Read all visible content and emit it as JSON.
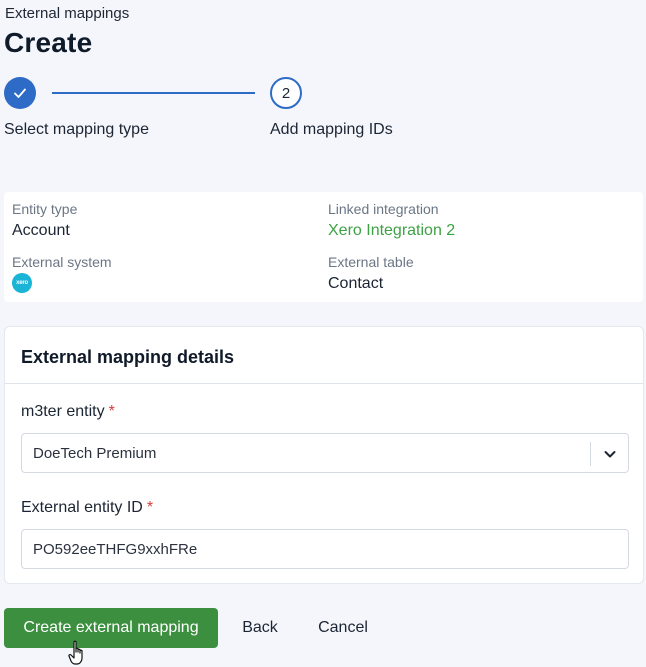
{
  "header": {
    "breadcrumb": "External mappings",
    "title": "Create"
  },
  "stepper": {
    "steps": [
      {
        "label": "Select mapping type",
        "state": "complete",
        "icon": "check-icon"
      },
      {
        "label": "Add mapping IDs",
        "state": "active",
        "number": "2"
      }
    ]
  },
  "summary": {
    "entity_type_label": "Entity type",
    "entity_type_value": "Account",
    "linked_integration_label": "Linked integration",
    "linked_integration_value": "Xero Integration 2",
    "external_system_label": "External system",
    "external_system_icon": "xero-logo-icon",
    "external_system_logo_text": "xero",
    "external_table_label": "External table",
    "external_table_value": "Contact"
  },
  "details": {
    "title": "External mapping details",
    "m3ter_entity_label": "m3ter entity",
    "m3ter_entity_value": "DoeTech Premium",
    "external_entity_id_label": "External entity ID",
    "external_entity_id_value": "PO592eeTHFG9xxhFRe",
    "required_marker": "*"
  },
  "actions": {
    "create_label": "Create external mapping",
    "back_label": "Back",
    "cancel_label": "Cancel"
  },
  "colors": {
    "primary_blue": "#2e6bc6",
    "primary_green": "#3b8f3f",
    "link_green": "#3da245",
    "required_red": "#d43c3c",
    "xero_blue": "#1ab4d7"
  }
}
